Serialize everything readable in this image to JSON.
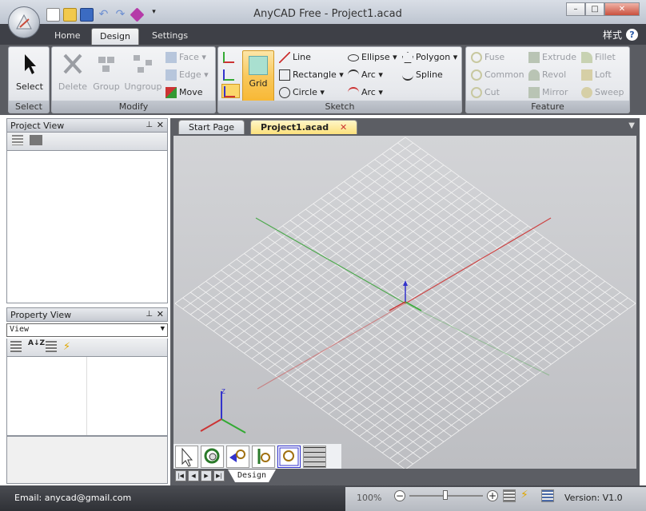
{
  "window": {
    "title": "AnyCAD Free - Project1.acad"
  },
  "ribbon_tabs": [
    {
      "label": "Home"
    },
    {
      "label": "Design"
    },
    {
      "label": "Settings"
    }
  ],
  "style_label": "样式",
  "groups": {
    "select": {
      "label": "Select",
      "select_btn": "Select"
    },
    "modify": {
      "label": "Modify",
      "delete": "Delete",
      "group": "Group",
      "ungroup": "Ungroup",
      "face": "Face",
      "edge": "Edge",
      "move": "Move"
    },
    "sketch": {
      "label": "Sketch",
      "grid": "Grid",
      "line": "Line",
      "rectangle": "Rectangle",
      "circle": "Circle",
      "ellipse": "Ellipse",
      "arc1": "Arc",
      "arc2": "Arc",
      "polygon": "Polygon",
      "spline": "Spline"
    },
    "feature": {
      "label": "Feature",
      "fuse": "Fuse",
      "common": "Common",
      "cut": "Cut",
      "extrude": "Extrude",
      "revol": "Revol",
      "mirror": "Mirror",
      "fillet": "Fillet",
      "loft": "Loft",
      "sweep": "Sweep"
    }
  },
  "project_view": {
    "title": "Project View"
  },
  "property_view": {
    "title": "Property View",
    "combo_value": "View"
  },
  "doc_tabs": [
    {
      "label": "Start Page"
    },
    {
      "label": "Project1.acad"
    }
  ],
  "sheet_tab": "Design",
  "status": {
    "email": "Email: anycad@gmail.com",
    "zoom": "100%",
    "version": "Version: V1.0"
  }
}
